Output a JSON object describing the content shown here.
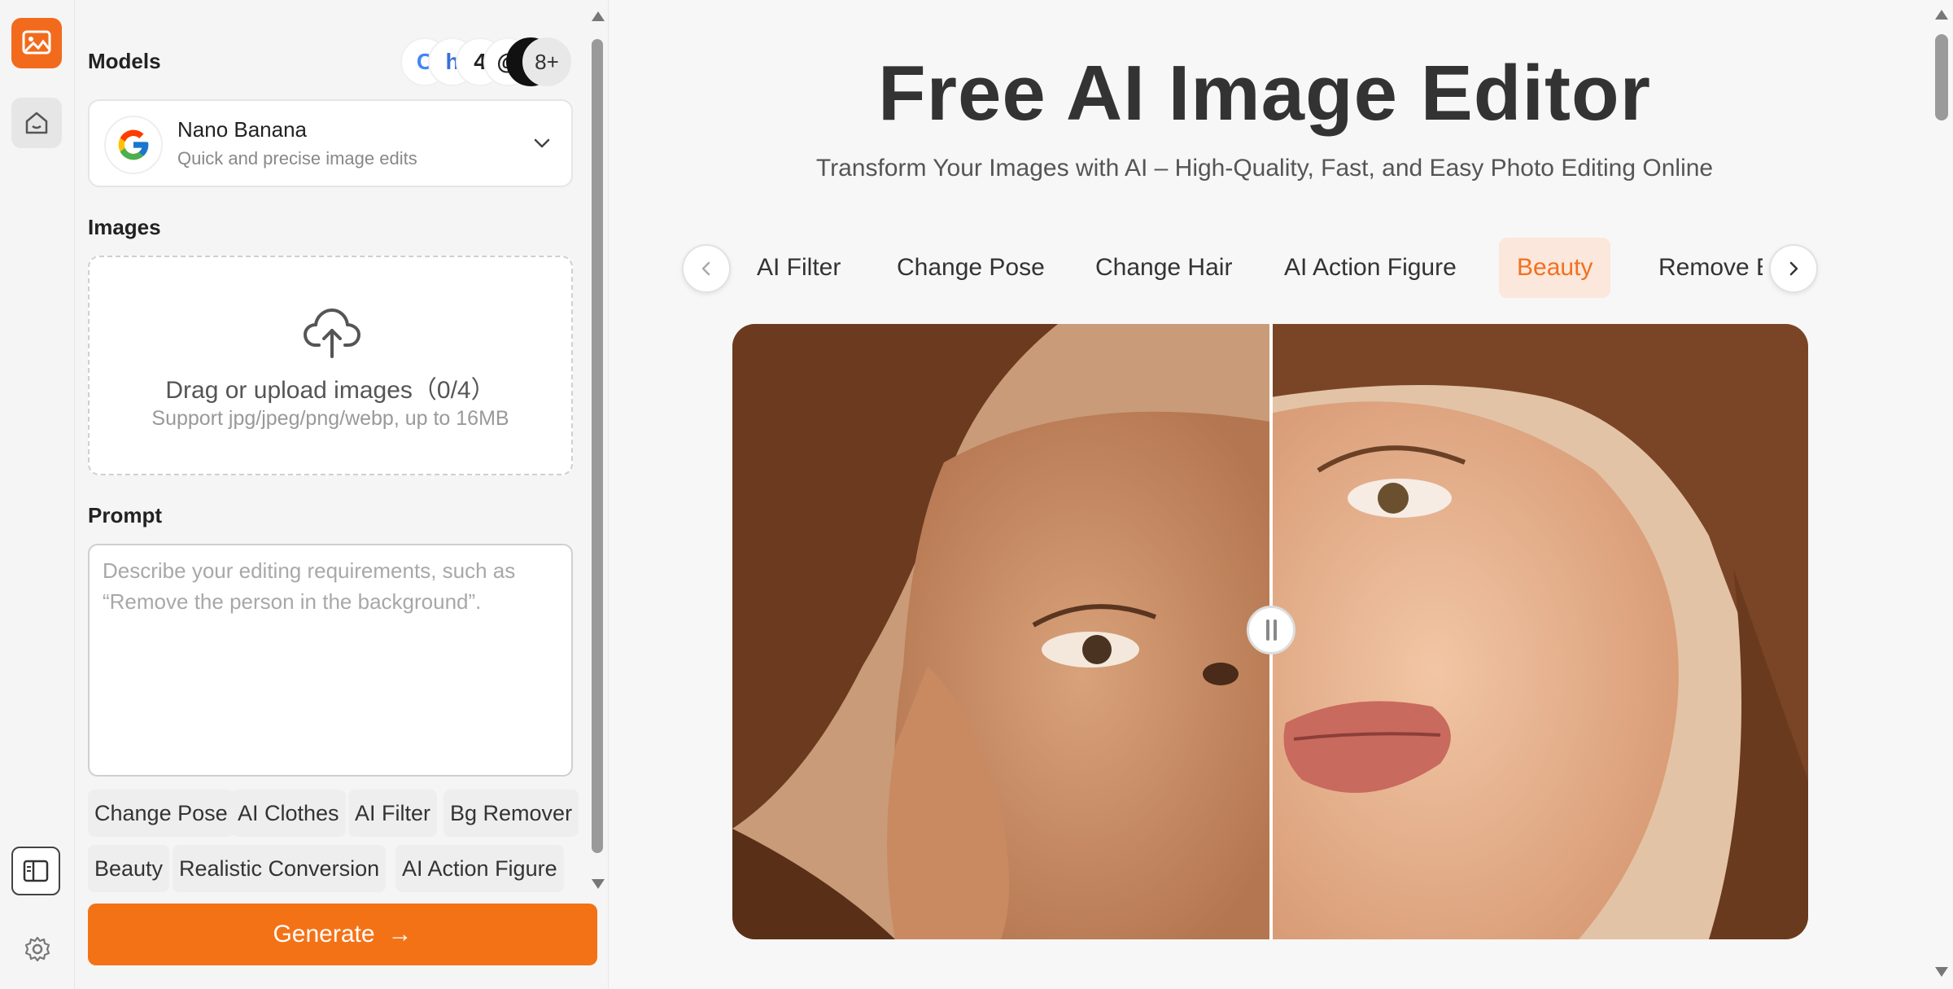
{
  "sidebar": {
    "models_title": "Models",
    "model_icons": [
      "C",
      "h",
      "4",
      "@",
      "4"
    ],
    "model_more": "8+",
    "selected_model": {
      "name": "Nano Banana",
      "description": "Quick and precise image edits",
      "logo": "google-g-icon"
    },
    "images_title": "Images",
    "upload": {
      "title": "Drag or upload images（0/4）",
      "subtitle": "Support jpg/jpeg/png/webp, up to 16MB"
    },
    "prompt_title": "Prompt",
    "prompt_placeholder": "Describe your editing requirements, such as “Remove the person in the background”.",
    "chips": [
      "Change Pose",
      "AI Clothes",
      "AI Filter",
      "Bg Remover",
      "Beauty",
      "Realistic Conversion",
      "AI Action Figure"
    ],
    "generate_label": "Generate",
    "generate_arrow": "→"
  },
  "main": {
    "title": "Free AI Image Editor",
    "subtitle": "Transform Your Images with AI – High-Quality, Fast, and Easy Photo Editing Online",
    "tabs": [
      {
        "label": "AI Filter",
        "active": false
      },
      {
        "label": "Change Pose",
        "active": false
      },
      {
        "label": "Change Hair",
        "active": false
      },
      {
        "label": "AI Action Figure",
        "active": false
      },
      {
        "label": "Beauty",
        "active": true
      },
      {
        "label": "Remove Background",
        "active": false
      }
    ]
  },
  "colors": {
    "accent": "#f47216",
    "active_tab_bg": "#fbe7db",
    "active_tab_text": "#f27020"
  }
}
